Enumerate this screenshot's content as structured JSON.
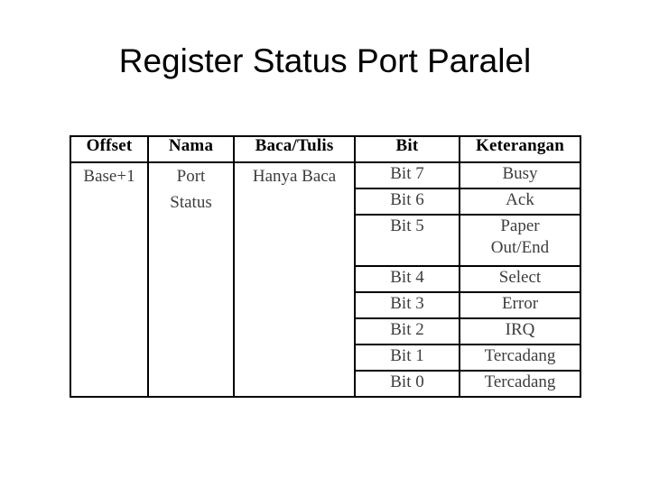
{
  "slide": {
    "title": "Register Status Port Paralel",
    "background_color": "#ffffff",
    "title_color": "#000000",
    "border_color": "#000000",
    "body_text_color": "#3d3d3d"
  },
  "table": {
    "headers": [
      "Offset",
      "Nama",
      "Baca/Tulis",
      "Bit",
      "Keterangan"
    ],
    "offset": "Base+1",
    "nama_line1": "Port",
    "nama_line2": "Status",
    "baca_tulis": "Hanya Baca",
    "rows": [
      {
        "bit": "Bit 7",
        "keterangan": "Busy",
        "keterangan_line2": ""
      },
      {
        "bit": "Bit 6",
        "keterangan": "Ack",
        "keterangan_line2": ""
      },
      {
        "bit": "Bit 5",
        "keterangan": "Paper",
        "keterangan_line2": "Out/End"
      },
      {
        "bit": "Bit 4",
        "keterangan": "Select",
        "keterangan_line2": ""
      },
      {
        "bit": "Bit 3",
        "keterangan": "Error",
        "keterangan_line2": ""
      },
      {
        "bit": "Bit 2",
        "keterangan": "IRQ",
        "keterangan_line2": ""
      },
      {
        "bit": "Bit 1",
        "keterangan": "Tercadang",
        "keterangan_line2": ""
      },
      {
        "bit": "Bit 0",
        "keterangan": "Tercadang",
        "keterangan_line2": ""
      }
    ]
  }
}
